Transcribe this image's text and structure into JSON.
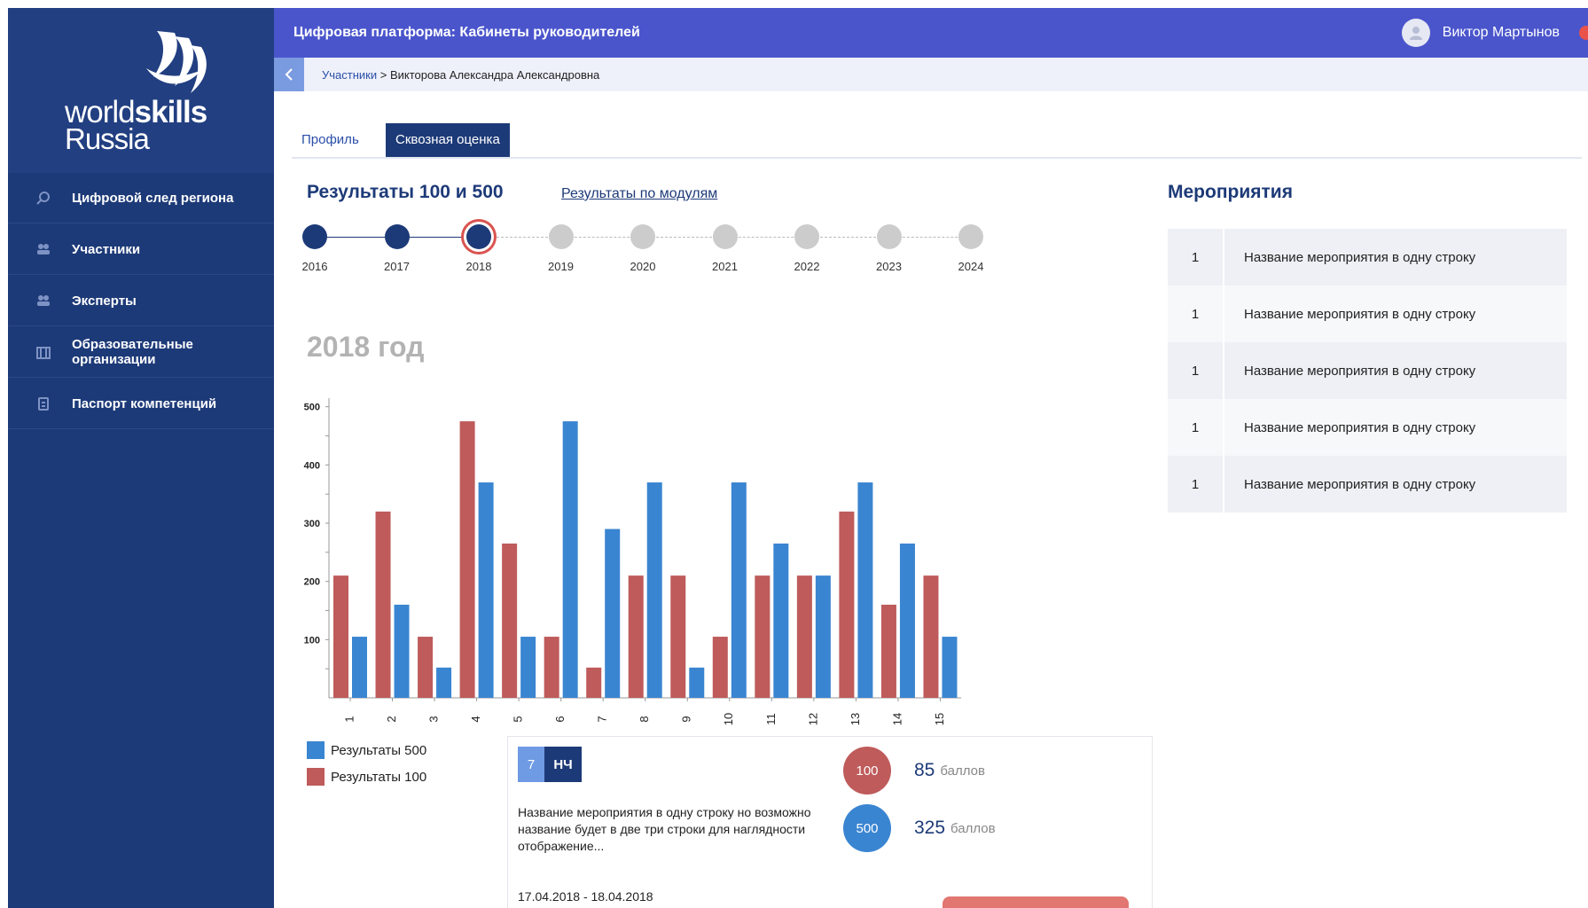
{
  "app": {
    "title": "Цифровая платформа: Кабинеты руководителей",
    "user_name": "Виктор Мартынов",
    "logo": {
      "line1_light": "world",
      "line1_bold": "skills",
      "line2": "Russia"
    }
  },
  "sidebar": {
    "items": [
      {
        "label": "Цифровой след региона",
        "icon": "search-icon"
      },
      {
        "label": "Участники",
        "icon": "users-icon"
      },
      {
        "label": "Эксперты",
        "icon": "experts-icon"
      },
      {
        "label": "Образовательные организации",
        "icon": "building-icon"
      },
      {
        "label": "Паспорт компетенций",
        "icon": "passport-icon"
      }
    ]
  },
  "breadcrumb": {
    "parent": "Участники",
    "separator": " > ",
    "current": "Викторова Александра Александровна"
  },
  "tabs": [
    {
      "label": "Профиль",
      "active": false
    },
    {
      "label": "Сквозная оценка",
      "active": true
    }
  ],
  "results": {
    "title": "Результаты 100 и 500",
    "module_link": "Результаты по модулям",
    "selected_year_heading": "2018 год"
  },
  "timeline": [
    {
      "year": "2016",
      "state": "done"
    },
    {
      "year": "2017",
      "state": "done"
    },
    {
      "year": "2018",
      "state": "current"
    },
    {
      "year": "2019",
      "state": "future"
    },
    {
      "year": "2020",
      "state": "future"
    },
    {
      "year": "2021",
      "state": "future"
    },
    {
      "year": "2022",
      "state": "future"
    },
    {
      "year": "2023",
      "state": "future"
    },
    {
      "year": "2024",
      "state": "future"
    }
  ],
  "chart_data": {
    "type": "bar",
    "categories": [
      "1",
      "2",
      "3",
      "4",
      "5",
      "6",
      "7",
      "8",
      "9",
      "10",
      "11",
      "12",
      "13",
      "14",
      "15"
    ],
    "series": [
      {
        "name": "Результаты 100",
        "color": "#bf5b5b",
        "values": [
          210,
          320,
          105,
          475,
          265,
          105,
          52,
          210,
          210,
          105,
          210,
          210,
          320,
          160,
          210
        ]
      },
      {
        "name": "Результаты 500",
        "color": "#3a85d1",
        "values": [
          105,
          160,
          52,
          370,
          105,
          475,
          290,
          370,
          52,
          370,
          265,
          210,
          370,
          265,
          105
        ]
      }
    ],
    "yticks": [
      100,
      200,
      300,
      400,
      500
    ],
    "ylim": [
      0,
      530
    ],
    "grid": false,
    "legend": "bottom-left"
  },
  "legend": [
    {
      "label": "Результаты 500",
      "color": "#3a85d1"
    },
    {
      "label": "Результаты 100",
      "color": "#bf5b5b"
    }
  ],
  "card": {
    "badge_num": "7",
    "badge_code": "НЧ",
    "description": "Название мероприятия в одну строку но возможно название будет в две три строки для наглядности отображение...",
    "dates": "17.04.2018 - 18.04.2018",
    "score100": {
      "label": "100",
      "value": "85",
      "unit": "баллов",
      "color": "#bf5b5b"
    },
    "score500": {
      "label": "500",
      "value": "325",
      "unit": "баллов",
      "color": "#3a85d1"
    }
  },
  "events": {
    "title": "Мероприятия",
    "rows": [
      {
        "num": "1",
        "name": "Название мероприятия в одну строку"
      },
      {
        "num": "1",
        "name": "Название мероприятия в одну строку"
      },
      {
        "num": "1",
        "name": "Название мероприятия в одну строку"
      },
      {
        "num": "1",
        "name": "Название мероприятия в одну строку"
      },
      {
        "num": "1",
        "name": "Название мероприятия в одну строку"
      }
    ]
  }
}
